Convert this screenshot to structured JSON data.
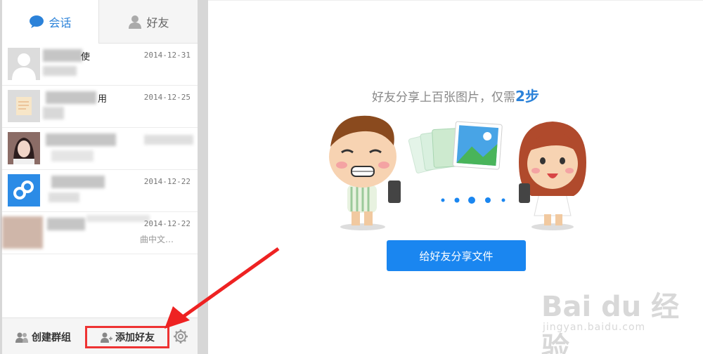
{
  "tabs": {
    "chat_label": "会话",
    "friends_label": "好友"
  },
  "conversations": [
    {
      "name": "使",
      "date": "2014-12-31",
      "preview": ""
    },
    {
      "name": "用",
      "date": "2014-12-25",
      "preview": ""
    },
    {
      "name": "",
      "date": "",
      "preview": ""
    },
    {
      "name": "",
      "date": "2014-12-22",
      "preview": ""
    },
    {
      "name": "",
      "date": "2014-12-22",
      "preview": "曲中文…"
    }
  ],
  "bottom_bar": {
    "create_group_label": "创建群组",
    "add_friend_label": "添加好友"
  },
  "main": {
    "headline_prefix": "好友分享上百张图片，仅需",
    "headline_highlight": "2步",
    "share_button_label": "给好友分享文件"
  },
  "watermark": {
    "brand": "Bai du 经验",
    "url": "jingyan.baidu.com"
  },
  "colors": {
    "accent": "#2b82d9",
    "button": "#1a86f0",
    "highlight_box": "#ee3333"
  }
}
